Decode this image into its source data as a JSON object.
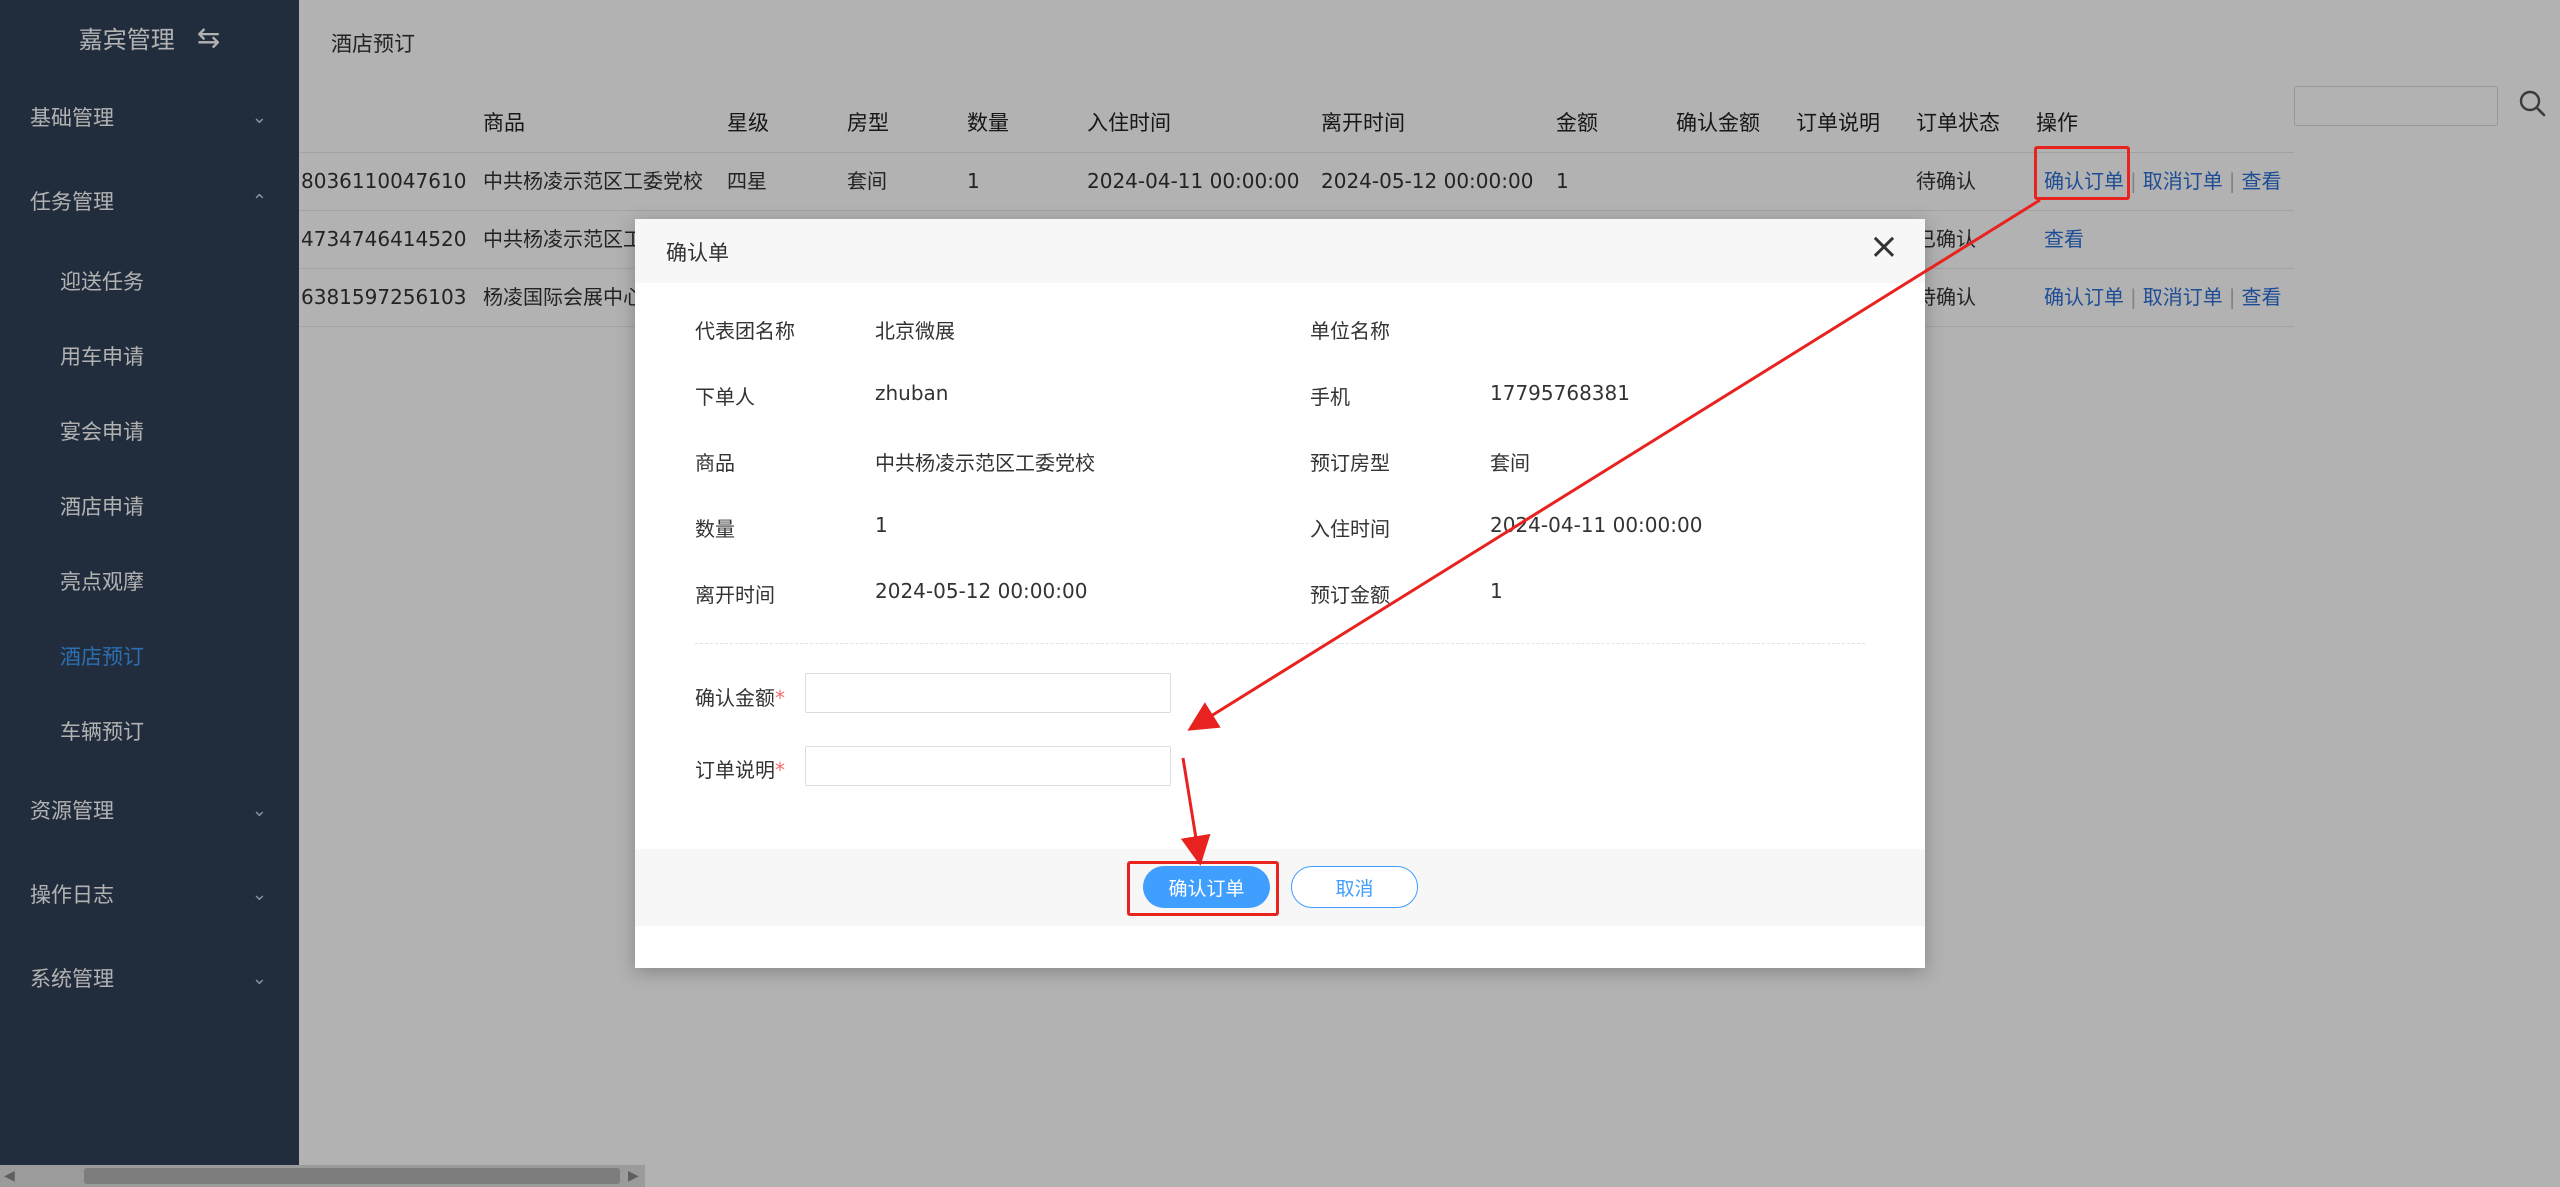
{
  "sidebar": {
    "title": "嘉宾管理",
    "groups": {
      "basic": "基础管理",
      "task": "任务管理",
      "resource": "资源管理",
      "log": "操作日志",
      "system": "系统管理"
    },
    "task_items": [
      "迎送任务",
      "用车申请",
      "宴会申请",
      "酒店申请",
      "亮点观摩",
      "酒店预订",
      "车辆预订"
    ],
    "active_item": "酒店预订"
  },
  "breadcrumb": "酒店预订",
  "table": {
    "headers": [
      "商品",
      "星级",
      "房型",
      "数量",
      "入住时间",
      "离开时间",
      "金额",
      "确认金额",
      "订单说明",
      "订单状态",
      "操作"
    ],
    "rows": [
      {
        "id": "8036110047610",
        "goods": "中共杨凌示范区工委党校",
        "star": "四星",
        "room": "套间",
        "qty": "1",
        "checkin": "2024-04-11 00:00:00",
        "checkout": "2024-05-12 00:00:00",
        "amount": "1",
        "status": "待确认"
      },
      {
        "id": "4734746414520",
        "goods": "中共杨凌示范区工",
        "status": "已确认"
      },
      {
        "id": "6381597256103",
        "goods": "杨凌国际会展中心",
        "status": "待确认"
      }
    ],
    "ops": {
      "confirm": "确认订单",
      "cancel": "取消订单",
      "view": "查看"
    }
  },
  "modal": {
    "title": "确认单",
    "fields": {
      "delegation_label": "代表团名称",
      "delegation_value": "北京微展",
      "unit_label": "单位名称",
      "unit_value": "",
      "orderer_label": "下单人",
      "orderer_value": "zhuban",
      "phone_label": "手机",
      "phone_value": "17795768381",
      "goods_label": "商品",
      "goods_value": "中共杨凌示范区工委党校",
      "room_label": "预订房型",
      "room_value": "套间",
      "qty_label": "数量",
      "qty_value": "1",
      "checkin_label": "入住时间",
      "checkin_value": "2024-04-11 00:00:00",
      "checkout_label": "离开时间",
      "checkout_value": "2024-05-12 00:00:00",
      "amount_label": "预订金额",
      "amount_value": "1"
    },
    "form": {
      "confirm_amount_label": "确认金额",
      "order_note_label": "订单说明",
      "required_mark": "*",
      "confirm_amount_value": "",
      "order_note_value": ""
    },
    "buttons": {
      "confirm": "确认订单",
      "cancel": "取消"
    }
  },
  "colors": {
    "sidebar": "#304156",
    "accent": "#409eff",
    "annotation": "#e8231f"
  }
}
